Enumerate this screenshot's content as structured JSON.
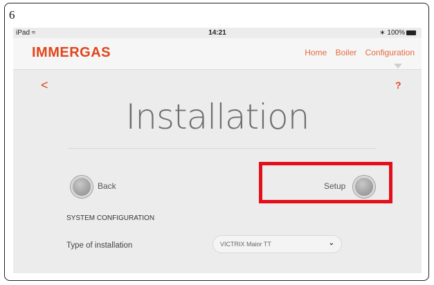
{
  "figure": {
    "page_number": "6"
  },
  "status_bar": {
    "device": "iPad",
    "time": "14:21",
    "battery": "100%"
  },
  "header": {
    "logo": "IMMERGAS",
    "nav": [
      "Home",
      "Boiler",
      "Configuration"
    ]
  },
  "page": {
    "back_glyph": "<",
    "help_glyph": "?",
    "title": "Installation"
  },
  "options": {
    "back_label": "Back",
    "setup_label": "Setup"
  },
  "section": {
    "title": "SYSTEM CONFIGURATION"
  },
  "field": {
    "label": "Type of installation",
    "value": "VICTRIX Maior TT",
    "chevron": "⌄"
  },
  "colors": {
    "accent": "#e0451b",
    "highlight": "#e3101c"
  }
}
